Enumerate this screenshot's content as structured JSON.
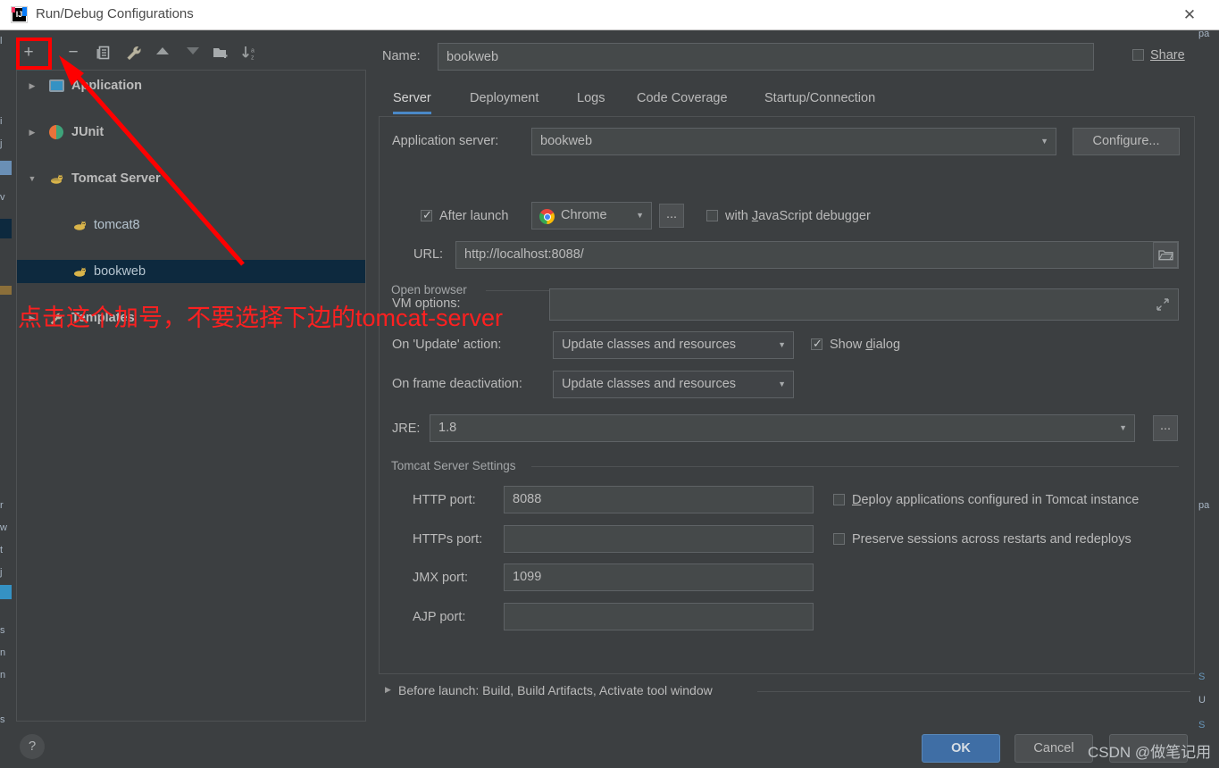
{
  "window": {
    "title": "Run/Debug Configurations",
    "app_icon": "intellij-idea-icon",
    "close_icon": "close-icon"
  },
  "toolbar": {
    "buttons": [
      {
        "name": "add-configuration-button",
        "glyph": "+",
        "title": "Add New Configuration"
      },
      {
        "name": "remove-configuration-button",
        "glyph": "−",
        "title": "Remove Configuration"
      },
      {
        "name": "copy-configuration-button",
        "glyph": "copy-icon",
        "title": "Copy Configuration"
      },
      {
        "name": "edit-templates-button",
        "glyph": "wrench-icon",
        "title": "Edit Templates"
      },
      {
        "name": "move-up-button",
        "glyph": "▲",
        "title": "Move Up"
      },
      {
        "name": "move-down-button",
        "glyph": "▼",
        "title": "Move Down"
      },
      {
        "name": "new-folder-button",
        "glyph": "folder-add-icon",
        "title": "Create New Folder"
      },
      {
        "name": "sort-alphabetically-button",
        "glyph": "sort-az-icon",
        "title": "Sort Configurations"
      }
    ]
  },
  "tree": {
    "items": [
      {
        "label": "Application",
        "icon": "application-icon",
        "expandable": true,
        "expanded": false,
        "level": 0,
        "selected": false
      },
      {
        "label": "JUnit",
        "icon": "junit-icon",
        "expandable": true,
        "expanded": false,
        "level": 0,
        "selected": false
      },
      {
        "label": "Tomcat Server",
        "icon": "tomcat-icon",
        "expandable": true,
        "expanded": true,
        "level": 0,
        "selected": false
      },
      {
        "label": "tomcat8",
        "icon": "tomcat-icon",
        "expandable": false,
        "expanded": false,
        "level": 1,
        "selected": false
      },
      {
        "label": "bookweb",
        "icon": "tomcat-icon",
        "expandable": false,
        "expanded": false,
        "level": 1,
        "selected": true
      },
      {
        "label": "Templates",
        "icon": "wrench-icon",
        "expandable": true,
        "expanded": false,
        "level": 0,
        "selected": false
      }
    ],
    "help_button": "?"
  },
  "header": {
    "name_label": "Name:",
    "name_value": "bookweb",
    "share_label": "Share",
    "share_checked": false
  },
  "tabs": [
    {
      "label": "Server",
      "active": true
    },
    {
      "label": "Deployment",
      "active": false
    },
    {
      "label": "Logs",
      "active": false
    },
    {
      "label": "Code Coverage",
      "active": false
    },
    {
      "label": "Startup/Connection",
      "active": false
    }
  ],
  "server_tab": {
    "application_server": {
      "label": "Application server:",
      "value": "bookweb",
      "configure_button": "Configure..."
    },
    "open_browser": {
      "group_title": "Open browser",
      "after_launch_label": "After launch",
      "after_launch_checked": true,
      "browser": "Chrome",
      "browser_icon": "chrome-icon",
      "browse_button": "...",
      "js_debugger_label_pre": "with ",
      "js_debugger_label_key": "J",
      "js_debugger_label_post": "avaScript debugger",
      "js_debugger_checked": false,
      "url_label": "URL:",
      "url_value": "http://localhost:8088/",
      "url_browse_icon": "folder-icon"
    },
    "vm_options": {
      "label": "VM options:",
      "value": "",
      "expand_icon": "expand-icon"
    },
    "on_update": {
      "label": "On 'Update' action:",
      "value": "Update classes and resources",
      "show_dialog_label_pre": "Show ",
      "show_dialog_label_key": "d",
      "show_dialog_label_post": "ialog",
      "show_dialog_checked": true
    },
    "on_frame_deactivation": {
      "label": "On frame deactivation:",
      "value": "Update classes and resources"
    },
    "jre": {
      "label": "JRE:",
      "value": "1.8",
      "browse_button": "..."
    },
    "tomcat_settings": {
      "group_title": "Tomcat Server Settings",
      "fields": [
        {
          "label": "HTTP port:",
          "value": "8088"
        },
        {
          "label": "HTTPs port:",
          "value": ""
        },
        {
          "label": "JMX port:",
          "value": "1099"
        },
        {
          "label": "AJP port:",
          "value": ""
        }
      ],
      "deploy_label_pre": "",
      "deploy_label_key": "D",
      "deploy_label_post": "eploy applications configured in Tomcat instance",
      "deploy_checked": false,
      "preserve_label": "Preserve sessions across restarts and redeploys",
      "preserve_checked": false
    }
  },
  "before_launch": {
    "text": "Before launch: Build, Build Artifacts, Activate tool window",
    "expanded": false
  },
  "dialog_buttons": {
    "ok": "OK",
    "cancel": "Cancel",
    "apply": ""
  },
  "annotations": {
    "highlight_target": "add-configuration-button",
    "note_text": "点击这个加号，不要选择下边的tomcat-server",
    "color": "#ff0000",
    "watermark": "CSDN @做笔记用"
  },
  "background": {
    "right_edge_texts": [
      "pa",
      "pa",
      "S",
      "U",
      "S"
    ],
    "left_edge_texts": [
      "l",
      "i",
      "j",
      "v",
      "r",
      "w",
      "t",
      "j",
      "s",
      "n",
      "n",
      "s"
    ]
  },
  "colors": {
    "dialog_bg": "#3c3f41",
    "titlebar_bg": "#ffffff",
    "input_bg": "#45494a",
    "border": "#5e6265",
    "text": "#bbbbbb",
    "accent": "#4a88c7",
    "selection": "#0d293e",
    "primary_button": "#3f6ea5",
    "annotation_red": "#ff0000"
  }
}
